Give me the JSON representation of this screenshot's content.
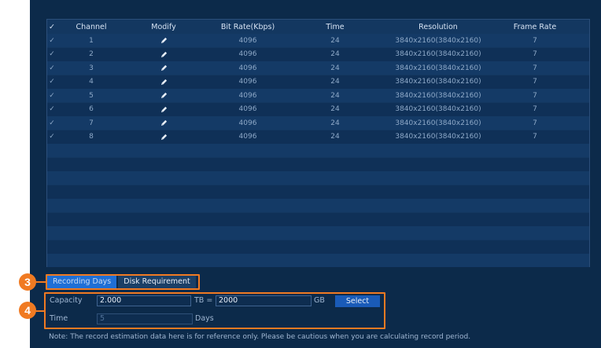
{
  "table": {
    "headers": [
      "✓",
      "Channel",
      "Modify",
      "Bit Rate(Kbps)",
      "Time",
      "Resolution",
      "Frame Rate"
    ],
    "rows": [
      {
        "check": "✓",
        "channel": "1",
        "bitrate": "4096",
        "time": "24",
        "resolution": "3840x2160(3840x2160)",
        "frame_rate": "7"
      },
      {
        "check": "✓",
        "channel": "2",
        "bitrate": "4096",
        "time": "24",
        "resolution": "3840x2160(3840x2160)",
        "frame_rate": "7"
      },
      {
        "check": "✓",
        "channel": "3",
        "bitrate": "4096",
        "time": "24",
        "resolution": "3840x2160(3840x2160)",
        "frame_rate": "7"
      },
      {
        "check": "✓",
        "channel": "4",
        "bitrate": "4096",
        "time": "24",
        "resolution": "3840x2160(3840x2160)",
        "frame_rate": "7"
      },
      {
        "check": "✓",
        "channel": "5",
        "bitrate": "4096",
        "time": "24",
        "resolution": "3840x2160(3840x2160)",
        "frame_rate": "7"
      },
      {
        "check": "✓",
        "channel": "6",
        "bitrate": "4096",
        "time": "24",
        "resolution": "3840x2160(3840x2160)",
        "frame_rate": "7"
      },
      {
        "check": "✓",
        "channel": "7",
        "bitrate": "4096",
        "time": "24",
        "resolution": "3840x2160(3840x2160)",
        "frame_rate": "7"
      },
      {
        "check": "✓",
        "channel": "8",
        "bitrate": "4096",
        "time": "24",
        "resolution": "3840x2160(3840x2160)",
        "frame_rate": "7"
      }
    ]
  },
  "tabs": {
    "recording_days": "Recording Days",
    "disk_requirement": "Disk Requirement"
  },
  "form": {
    "capacity_label": "Capacity",
    "capacity_value": "2.000",
    "tb_equals": "TB =",
    "gb_value": "2000",
    "gb_unit": "GB",
    "select_button": "Select",
    "time_label": "Time",
    "time_value": "5",
    "days_unit": "Days"
  },
  "note": "Note: The record estimation data here is for reference only. Please be cautious when you are calculating record period.",
  "callouts": {
    "three": "3",
    "four": "4"
  },
  "colors": {
    "accent": "#f07a22",
    "active_tab": "#1f6fd6",
    "panel": "#0c2a4a"
  },
  "icons": {
    "modify": "pencil-icon"
  }
}
